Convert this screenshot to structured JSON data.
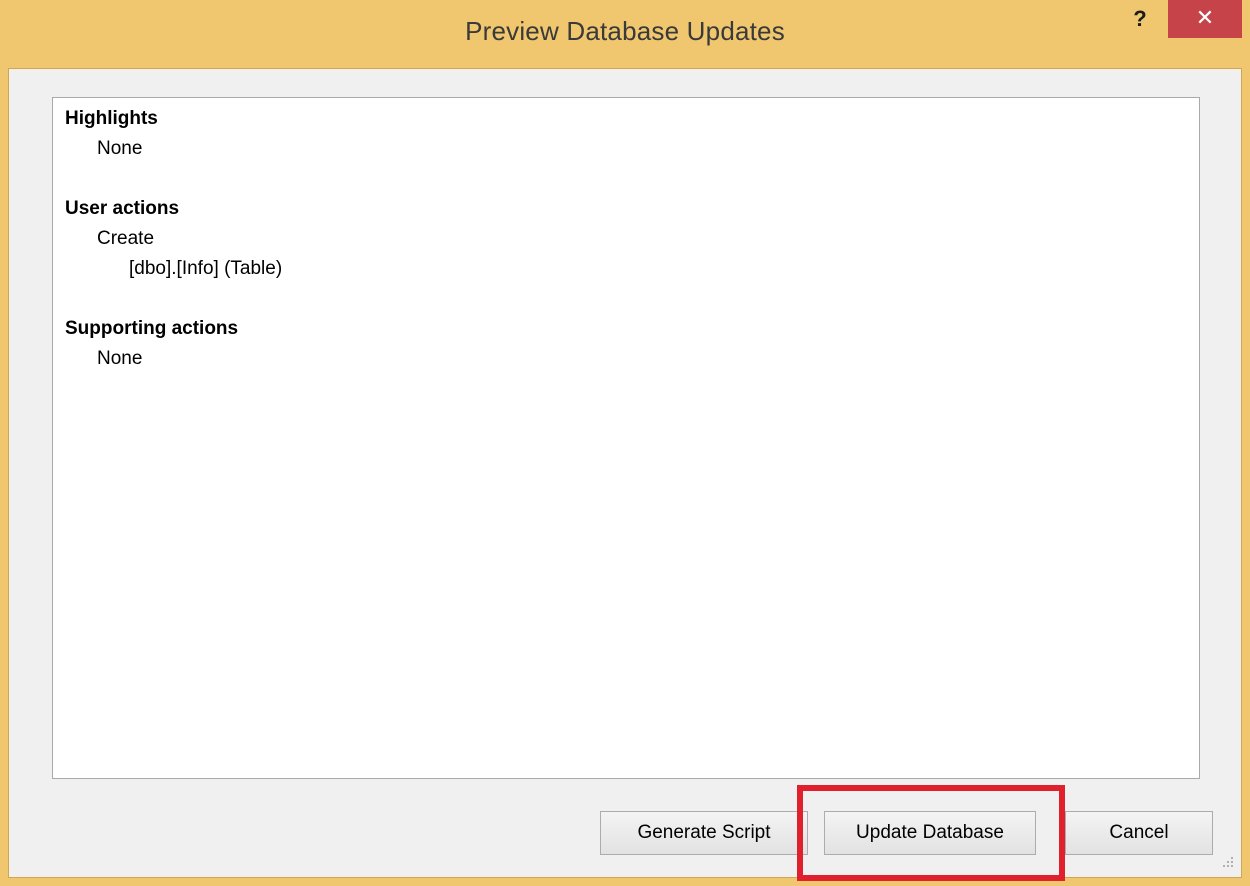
{
  "window": {
    "title": "Preview Database Updates",
    "help_label": "?",
    "close_label": "✕"
  },
  "summary": {
    "highlights": {
      "heading": "Highlights",
      "items": [
        "None"
      ]
    },
    "user_actions": {
      "heading": "User actions",
      "action": "Create",
      "targets": [
        "[dbo].[Info] (Table)"
      ]
    },
    "supporting_actions": {
      "heading": "Supporting actions",
      "items": [
        "None"
      ]
    }
  },
  "buttons": {
    "generate_script": "Generate Script",
    "update_database": "Update Database",
    "cancel": "Cancel"
  },
  "colors": {
    "title_bar": "#f0c76e",
    "close_button": "#c7434a",
    "highlight_box": "#e0202c"
  }
}
